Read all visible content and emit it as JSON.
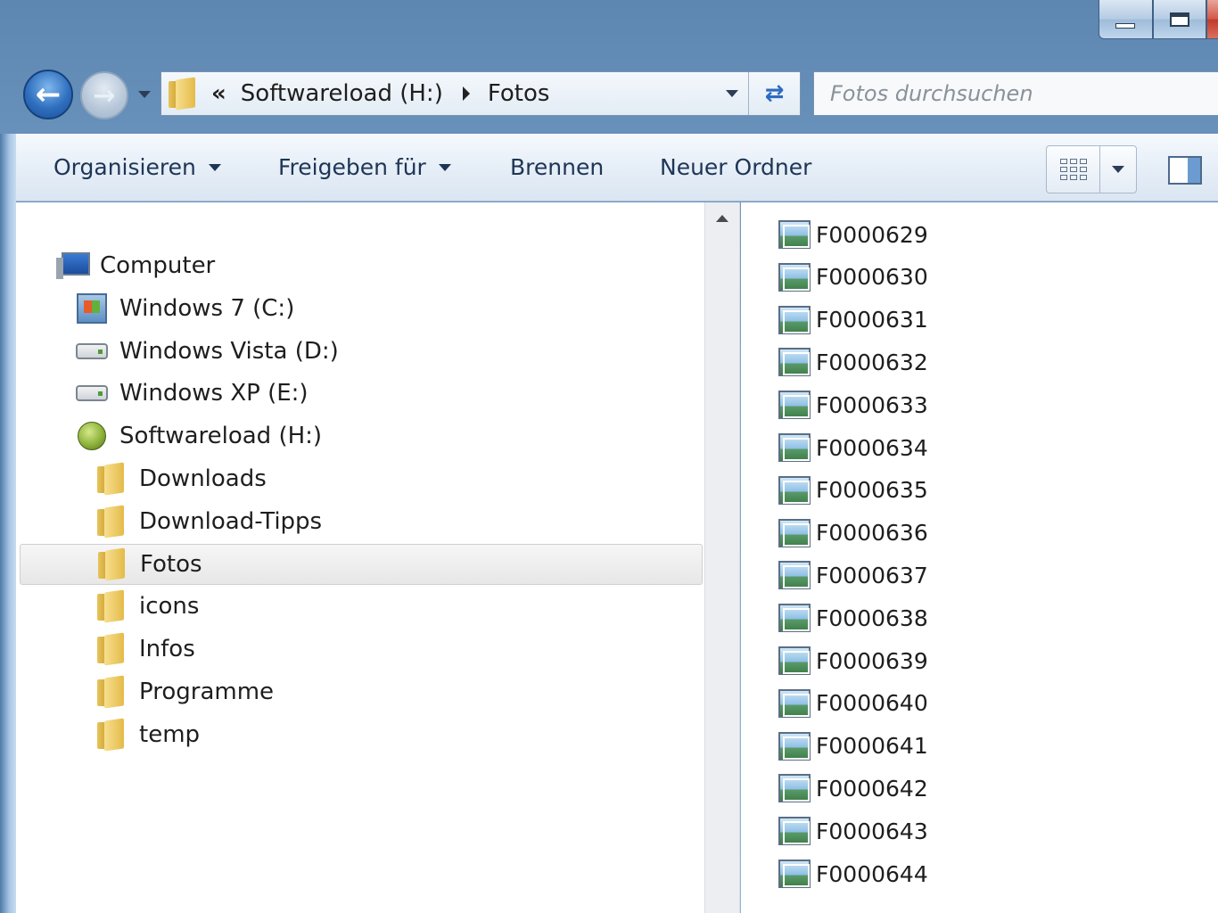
{
  "window": {
    "accent": "#7aa3cc"
  },
  "address": {
    "overflow": "«",
    "segments": [
      "Softwareload (H:)",
      "Fotos"
    ]
  },
  "search": {
    "placeholder": "Fotos durchsuchen"
  },
  "toolbar": {
    "organize": "Organisieren",
    "share": "Freigeben für",
    "burn": "Brennen",
    "new_folder": "Neuer Ordner"
  },
  "tree": [
    {
      "label": "Computer",
      "icon": "computer-icon"
    },
    {
      "label": "Windows 7 (C:)",
      "icon": "windows-drive-icon"
    },
    {
      "label": "Windows Vista (D:)",
      "icon": "hard-drive-icon"
    },
    {
      "label": "Windows XP (E:)",
      "icon": "hard-drive-icon"
    },
    {
      "label": "Softwareload (H:)",
      "icon": "apple-drive-icon"
    },
    {
      "label": "Downloads",
      "icon": "folder-icon"
    },
    {
      "label": "Download-Tipps",
      "icon": "folder-icon"
    },
    {
      "label": "Fotos",
      "icon": "folder-icon",
      "selected": true
    },
    {
      "label": "icons",
      "icon": "folder-icon"
    },
    {
      "label": "Infos",
      "icon": "folder-icon"
    },
    {
      "label": "Programme",
      "icon": "folder-icon"
    },
    {
      "label": "temp",
      "icon": "folder-icon"
    }
  ],
  "files": [
    "F0000629",
    "F0000630",
    "F0000631",
    "F0000632",
    "F0000633",
    "F0000634",
    "F0000635",
    "F0000636",
    "F0000637",
    "F0000638",
    "F0000639",
    "F0000640",
    "F0000641",
    "F0000642",
    "F0000643",
    "F0000644"
  ]
}
